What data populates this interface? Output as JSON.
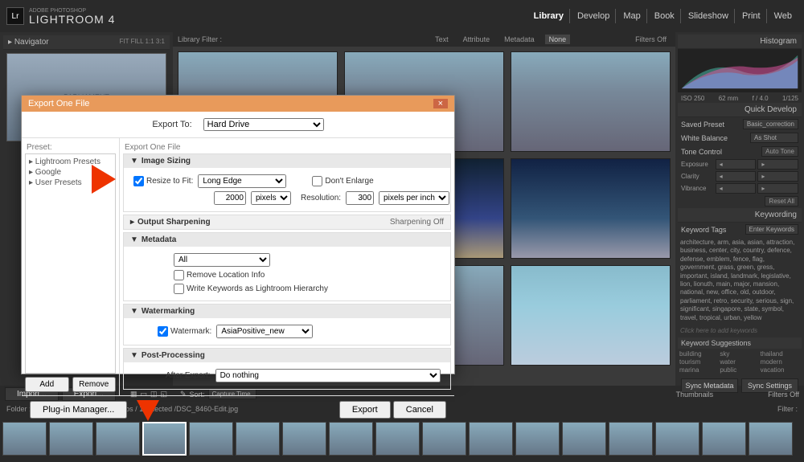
{
  "app": {
    "vendor": "ADOBE PHOTOSHOP",
    "name": "LIGHTROOM 4",
    "logo": "Lr"
  },
  "modules": [
    "Library",
    "Develop",
    "Map",
    "Book",
    "Slideshow",
    "Print",
    "Web"
  ],
  "activeModule": "Library",
  "navigator": {
    "title": "Navigator",
    "fit": "FIT",
    "fill": "FILL",
    "r1": "1:1",
    "r2": "3:1"
  },
  "leftButtons": {
    "import": "Import...",
    "export": "Export..."
  },
  "libraryFilter": {
    "label": "Library Filter :",
    "tabs": [
      "Text",
      "Attribute",
      "Metadata",
      "None"
    ],
    "filtersOff": "Filters Off"
  },
  "right": {
    "histogram": "Histogram",
    "meta": {
      "iso": "ISO 250",
      "focal": "62 mm",
      "ap": "f / 4.0",
      "sh": "1/125"
    },
    "quickDev": "Quick Develop",
    "savedPreset": {
      "l": "Saved Preset",
      "v": "Basic_correction"
    },
    "whiteBal": {
      "l": "White Balance",
      "v": "As Shot"
    },
    "toneCtrl": {
      "l": "Tone Control",
      "btn": "Auto Tone"
    },
    "sliders": [
      "Exposure",
      "Clarity",
      "Vibrance"
    ],
    "resetAll": "Reset All",
    "keywording": "Keywording",
    "kwTags": {
      "l": "Keyword Tags",
      "v": "Enter Keywords"
    },
    "kwList": "architecture, arm, asia, asian, attraction, business, center, city, country, defence, defense, emblem, fence, flag, government, grass, green, gress, important, island, landmark, legislative, lion, lionuth, main, major, mansion, national, new, office, old, outdoor, parliament, retro, security, serious, sign, significant, singapore, state, symbol, travel, tropical, urban, yellow",
    "addKw": "Click here to add keywords",
    "kwSugg": "Keyword Suggestions",
    "sugg": [
      "building",
      "sky",
      "thailand",
      "tourism",
      "water",
      "modern",
      "marina",
      "public",
      "vacation"
    ],
    "sync": {
      "meta": "Sync Metadata",
      "set": "Sync Settings"
    }
  },
  "toolbar": {
    "sort": "Sort:",
    "sortBy": "Capture Time",
    "thumbs": "Thumbnails",
    "filtersOff": "Filters Off"
  },
  "status": {
    "folder": "Folder : Singapore_for_A...",
    "count": "24 photos / 1 selected /DSC_8460-Edit.jpg",
    "filter": "Filter :"
  },
  "dialog": {
    "title": "Export One File",
    "exportTo": {
      "l": "Export To:",
      "v": "Hard Drive"
    },
    "presetLbl": "Preset:",
    "presets": [
      "▸ Lightroom Presets",
      "▸ Google",
      "▸ User Presets"
    ],
    "presetBtns": {
      "add": "Add",
      "remove": "Remove"
    },
    "plugin": "Plug-in Manager...",
    "settingsLbl": "Export One File",
    "sections": {
      "sizing": {
        "title": "Image Sizing",
        "resize": "Resize to Fit:",
        "resizeV": "Long Edge",
        "dontEnlarge": "Don't Enlarge",
        "sizeV": "2000",
        "sizeU": "pixels",
        "resLbl": "Resolution:",
        "resV": "300",
        "resU": "pixels per inch"
      },
      "sharpen": {
        "title": "Output Sharpening",
        "right": "Sharpening Off"
      },
      "metadata": {
        "title": "Metadata",
        "scope": "All",
        "removeLoc": "Remove Location Info",
        "writeKw": "Write Keywords as Lightroom Hierarchy"
      },
      "watermark": {
        "title": "Watermarking",
        "chk": "Watermark:",
        "v": "AsiaPositive_new"
      },
      "post": {
        "title": "Post-Processing",
        "after": "After Export:",
        "v": "Do nothing"
      }
    },
    "buttons": {
      "export": "Export",
      "cancel": "Cancel"
    }
  }
}
